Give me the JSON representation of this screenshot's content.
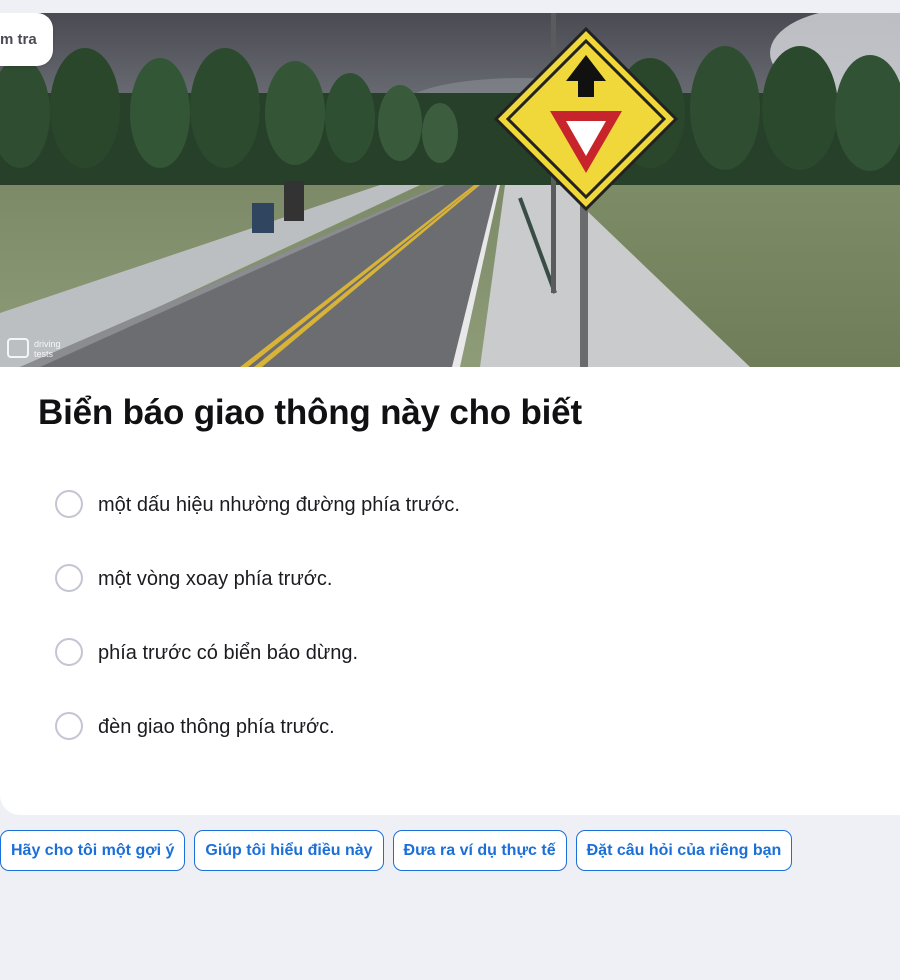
{
  "header": {
    "badge_label": "m tra"
  },
  "image": {
    "watermark_text": "driving tests"
  },
  "question": {
    "title": "Biển báo giao thông này cho biết"
  },
  "options": [
    {
      "label": "một dấu hiệu nhường đường phía trước."
    },
    {
      "label": "một vòng xoay phía trước."
    },
    {
      "label": "phía trước có biển báo dừng."
    },
    {
      "label": "đèn giao thông phía trước."
    }
  ],
  "help_chips": [
    {
      "label": "Hãy cho tôi một gợi ý"
    },
    {
      "label": "Giúp tôi hiểu điều này"
    },
    {
      "label": "Đưa ra ví dụ thực tế"
    },
    {
      "label": "Đặt câu hỏi của riêng bạn"
    }
  ],
  "colors": {
    "page_background": "#eff0f5",
    "accent_blue": "#1b6fd8",
    "sign_yellow": "#f0d83a",
    "sign_red": "#c8242b"
  },
  "icons": {
    "radio": "radio-empty-icon",
    "sign": "yield-ahead-sign-icon",
    "watermark": "driving-tests-logo-icon"
  }
}
